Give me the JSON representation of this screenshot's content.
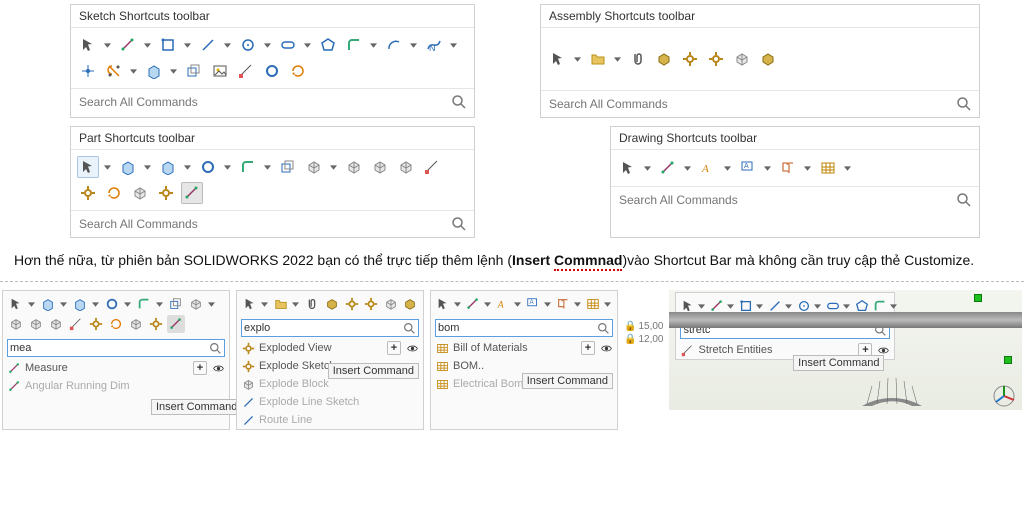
{
  "panels": {
    "sketch": {
      "title": "Sketch Shortcuts toolbar",
      "search_placeholder": "Search All Commands"
    },
    "assembly": {
      "title": "Assembly Shortcuts toolbar",
      "search_placeholder": "Search All Commands"
    },
    "part": {
      "title": "Part Shortcuts toolbar",
      "search_placeholder": "Search All Commands"
    },
    "drawing": {
      "title": "Drawing Shortcuts toolbar",
      "search_placeholder": "Search All Commands"
    }
  },
  "body_text": {
    "pre": "Hơn thế nữa, từ phiên bản SOLIDWORKS 2022 bạn có thể trực tiếp thêm lệnh (",
    "bold1": "Insert ",
    "bold2_red": "Commnad",
    "mid": ")vào Shortcut Bar mà không cần truy cập thẻ Customize."
  },
  "mini": {
    "part": {
      "search_value": "mea",
      "suggestions": [
        {
          "label": "Measure",
          "enabled": true
        },
        {
          "label": "Angular Running Dim",
          "enabled": false
        }
      ],
      "insert_label": "Insert Command"
    },
    "assembly": {
      "search_value": "explo",
      "suggestions": [
        {
          "label": "Exploded View",
          "enabled": true
        },
        {
          "label": "Explode Sketch..",
          "enabled": true
        },
        {
          "label": "Explode Block",
          "enabled": false
        },
        {
          "label": "Explode Line Sketch",
          "enabled": false
        },
        {
          "label": "Route Line",
          "enabled": false
        }
      ],
      "insert_label": "Insert Command"
    },
    "drawing": {
      "search_value": "bom",
      "suggestions": [
        {
          "label": "Bill of Materials",
          "enabled": true
        },
        {
          "label": "BOM..",
          "enabled": true
        },
        {
          "label": "Electrical Bom..",
          "enabled": false
        }
      ],
      "insert_label": "Insert Command"
    },
    "sketch": {
      "search_value": "stretc",
      "suggestions": [
        {
          "label": "Stretch Entities",
          "enabled": true
        }
      ],
      "insert_label": "Insert Command"
    }
  },
  "dims": {
    "v1": "15,00",
    "v2": "12,00"
  }
}
